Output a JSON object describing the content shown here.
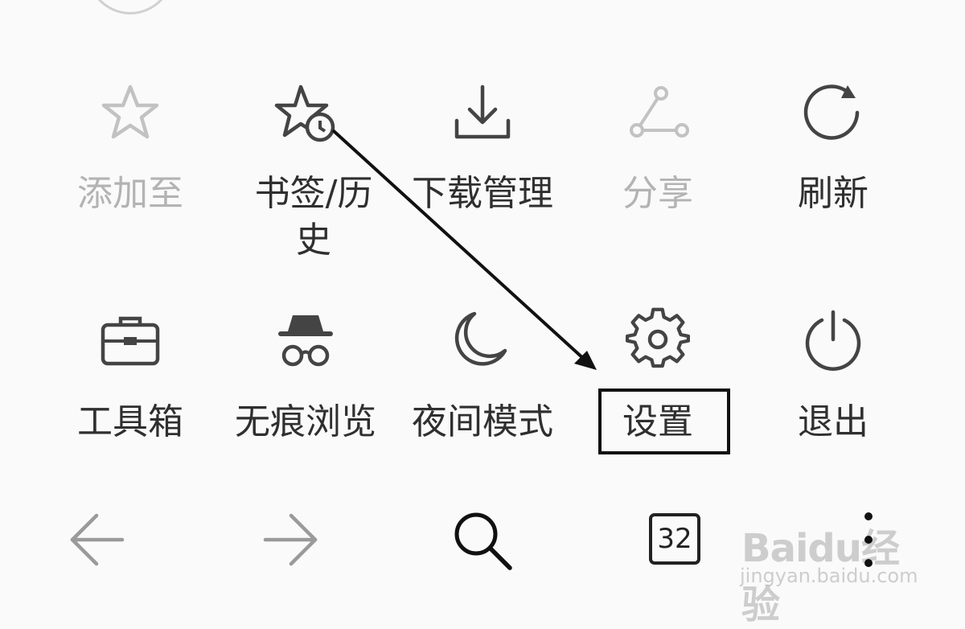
{
  "menu": {
    "row1": [
      {
        "label": "添加至",
        "icon": "star-icon",
        "state": "disabled"
      },
      {
        "label": "书签/历史",
        "icon": "bookmark-history-icon",
        "state": "enabled"
      },
      {
        "label": "下载管理",
        "icon": "download-icon",
        "state": "enabled"
      },
      {
        "label": "分享",
        "icon": "share-icon",
        "state": "disabled"
      },
      {
        "label": "刷新",
        "icon": "refresh-icon",
        "state": "enabled"
      }
    ],
    "row2": [
      {
        "label": "工具箱",
        "icon": "toolbox-icon",
        "state": "enabled"
      },
      {
        "label": "无痕浏览",
        "icon": "incognito-icon",
        "state": "enabled"
      },
      {
        "label": "夜间模式",
        "icon": "moon-icon",
        "state": "enabled"
      },
      {
        "label": "设置",
        "icon": "gear-icon",
        "state": "enabled",
        "highlighted": true
      },
      {
        "label": "退出",
        "icon": "power-icon",
        "state": "enabled"
      }
    ]
  },
  "bottom_bar": {
    "back": "arrow-left-icon",
    "forward": "arrow-right-icon",
    "search": "search-icon",
    "tab_count": "32",
    "more": "more-vertical-icon"
  },
  "watermark": {
    "logo": "Baidu经验",
    "url": "jingyan.baidu.com"
  },
  "colors": {
    "background": "#fafafa",
    "icon_active": "#444444",
    "icon_disabled": "#c2c2c2",
    "annotation": "#111111"
  }
}
